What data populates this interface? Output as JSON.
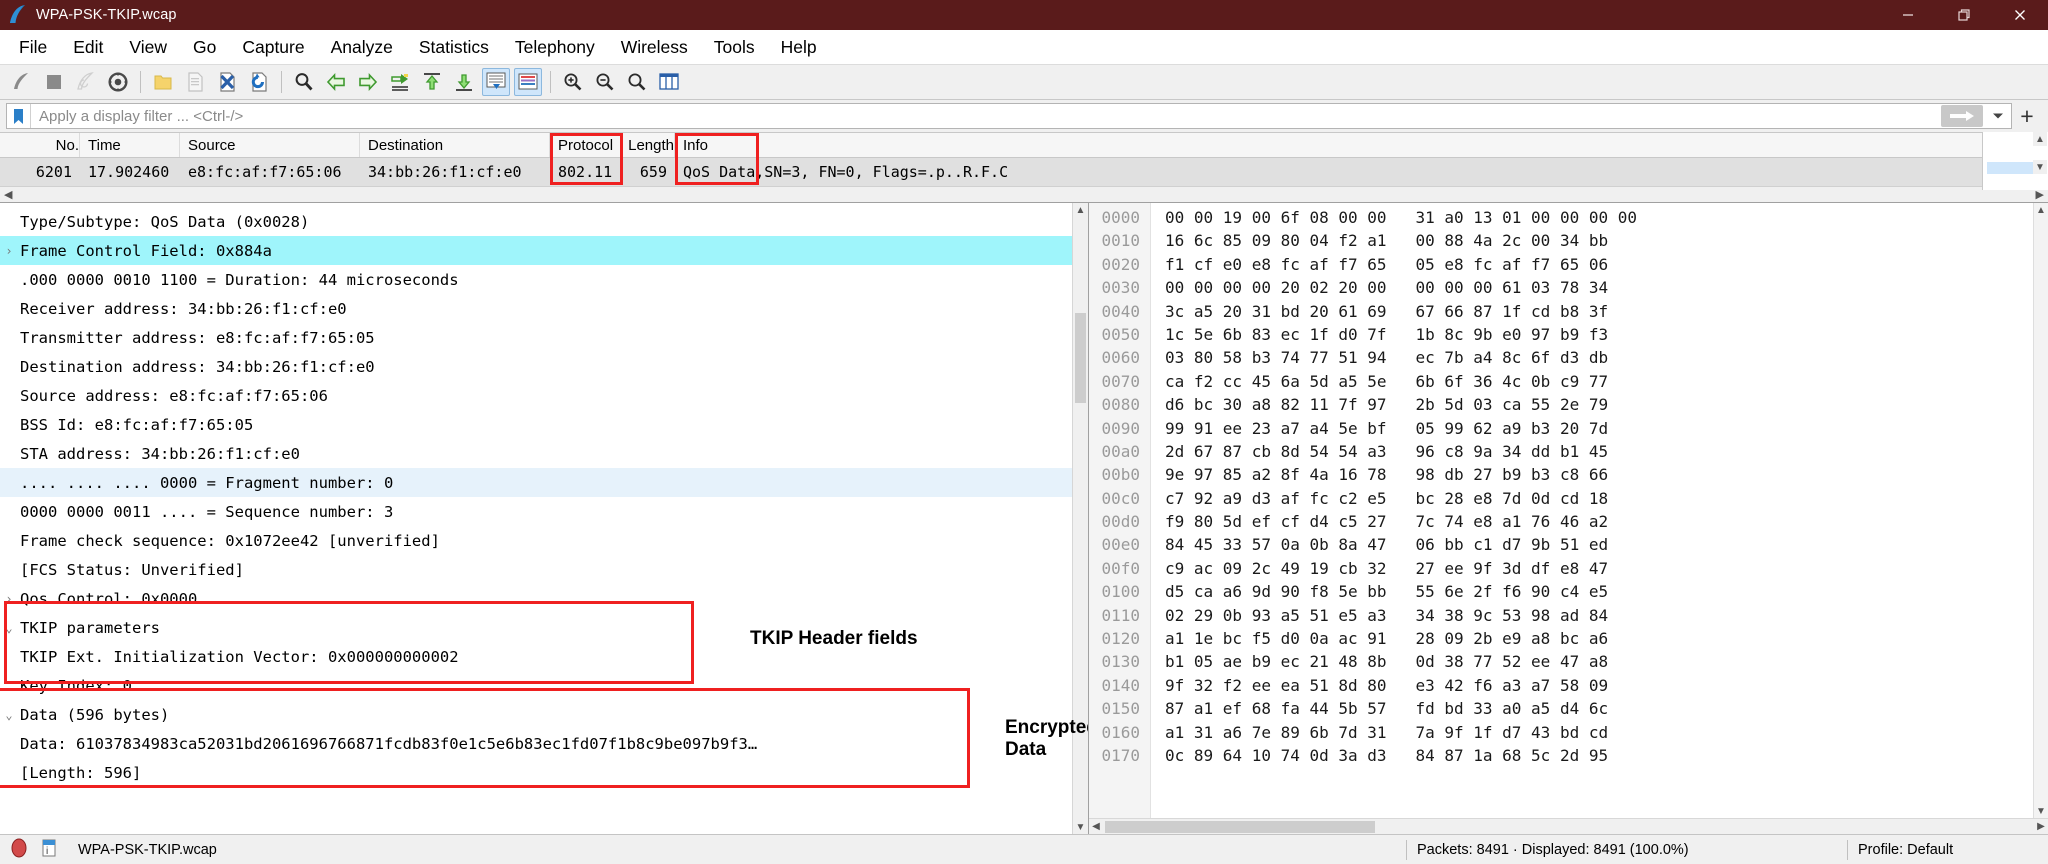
{
  "window": {
    "title": "WPA-PSK-TKIP.wcap",
    "logo_icon": "wireshark-fin-icon",
    "minimize_label": "–",
    "maximize_label": "❐",
    "close_label": "✕"
  },
  "menubar": {
    "items": [
      "File",
      "Edit",
      "View",
      "Go",
      "Capture",
      "Analyze",
      "Statistics",
      "Telephony",
      "Wireless",
      "Tools",
      "Help"
    ]
  },
  "toolbar": {
    "buttons": [
      {
        "name": "start-capture-icon",
        "label": "Start"
      },
      {
        "name": "stop-capture-icon",
        "label": "Stop"
      },
      {
        "name": "restart-capture-icon",
        "label": "Restart"
      },
      {
        "name": "capture-options-icon",
        "label": "Capture options"
      },
      {
        "name": "open-file-icon",
        "label": "Open"
      },
      {
        "name": "save-file-icon",
        "label": "Save"
      },
      {
        "name": "close-file-icon",
        "label": "Close"
      },
      {
        "name": "reload-file-icon",
        "label": "Reload"
      },
      {
        "name": "find-packet-icon",
        "label": "Find packet"
      },
      {
        "name": "go-back-icon",
        "label": "Go back"
      },
      {
        "name": "go-forward-icon",
        "label": "Go forward"
      },
      {
        "name": "go-to-packet-icon",
        "label": "Go to packet"
      },
      {
        "name": "go-first-packet-icon",
        "label": "Go to first packet"
      },
      {
        "name": "go-last-packet-icon",
        "label": "Go to last packet"
      },
      {
        "name": "autoscroll-icon",
        "label": "Auto scroll"
      },
      {
        "name": "colorize-icon",
        "label": "Colorize"
      },
      {
        "name": "zoom-in-icon",
        "label": "Zoom in"
      },
      {
        "name": "zoom-out-icon",
        "label": "Zoom out"
      },
      {
        "name": "zoom-reset-icon",
        "label": "Normal size"
      },
      {
        "name": "resize-columns-icon",
        "label": "Resize columns"
      }
    ]
  },
  "filter": {
    "bookmark_icon": "bookmark-icon",
    "placeholder": "Apply a display filter ... <Ctrl-/>",
    "value": "",
    "apply_icon": "arrow-right-icon",
    "dropdown_icon": "chevron-down-icon",
    "add_icon": "plus-icon"
  },
  "packet_list": {
    "columns": [
      "No.",
      "Time",
      "Source",
      "Destination",
      "Protocol",
      "Length",
      "Info"
    ],
    "highlighted_columns": [
      "Protocol",
      "Info"
    ],
    "rows": [
      {
        "no": "6201",
        "time": "17.902460",
        "source": "e8:fc:af:f7:65:06",
        "destination": "34:bb:26:f1:cf:e0",
        "protocol": "802.11",
        "length": "659",
        "info_highlight": "QoS Data,",
        "info_rest": " SN=3, FN=0, Flags=.p..R.F.C"
      }
    ]
  },
  "detail_tree": {
    "rows": [
      {
        "twisty": "",
        "indent": 1,
        "text": "Type/Subtype: QoS Data (0x0028)",
        "highlight": "none"
      },
      {
        "twisty": "›",
        "indent": 1,
        "text": "Frame Control Field: 0x884a",
        "highlight": "cyan"
      },
      {
        "twisty": "",
        "indent": 1,
        "text": ".000 0000 0010 1100 = Duration: 44 microseconds",
        "highlight": "none"
      },
      {
        "twisty": "",
        "indent": 1,
        "text": "Receiver address: 34:bb:26:f1:cf:e0",
        "highlight": "none"
      },
      {
        "twisty": "",
        "indent": 1,
        "text": "Transmitter address: e8:fc:af:f7:65:05",
        "highlight": "none"
      },
      {
        "twisty": "",
        "indent": 1,
        "text": "Destination address: 34:bb:26:f1:cf:e0",
        "highlight": "none"
      },
      {
        "twisty": "",
        "indent": 1,
        "text": "Source address: e8:fc:af:f7:65:06",
        "highlight": "none"
      },
      {
        "twisty": "",
        "indent": 1,
        "text": "BSS Id: e8:fc:af:f7:65:05",
        "highlight": "none"
      },
      {
        "twisty": "",
        "indent": 1,
        "text": "STA address: 34:bb:26:f1:cf:e0",
        "highlight": "none"
      },
      {
        "twisty": "",
        "indent": 1,
        "text": ".... .... .... 0000 = Fragment number: 0",
        "highlight": "blue"
      },
      {
        "twisty": "",
        "indent": 1,
        "text": "0000 0000 0011 .... = Sequence number: 3",
        "highlight": "none"
      },
      {
        "twisty": "",
        "indent": 1,
        "text": "Frame check sequence: 0x1072ee42 [unverified]",
        "highlight": "none"
      },
      {
        "twisty": "",
        "indent": 1,
        "text": "[FCS Status: Unverified]",
        "highlight": "none"
      },
      {
        "twisty": "›",
        "indent": 1,
        "text": "Qos Control: 0x0000",
        "highlight": "none"
      },
      {
        "twisty": "⌄",
        "indent": 1,
        "text": "TKIP parameters",
        "highlight": "none"
      },
      {
        "twisty": "",
        "indent": 2,
        "text": "TKIP Ext. Initialization Vector: 0x000000000002",
        "highlight": "none"
      },
      {
        "twisty": "",
        "indent": 2,
        "text": "Key Index: 0",
        "highlight": "none"
      },
      {
        "twisty": "⌄",
        "indent": 0,
        "text": "Data (596 bytes)",
        "highlight": "none"
      },
      {
        "twisty": "",
        "indent": 2,
        "text": "Data: 61037834983ca52031bd2061696766871fcdb83f0e1c5e6b83ec1fd07f1b8c9be097b9f3…",
        "highlight": "none"
      },
      {
        "twisty": "",
        "indent": 2,
        "text": "[Length: 596]",
        "highlight": "none"
      }
    ]
  },
  "annotations": [
    {
      "name": "tkip-header-fields-annotation",
      "text": "TKIP Header fields"
    },
    {
      "name": "encrypted-data-annotation",
      "text": "Encrypted Data"
    }
  ],
  "hex_dump": {
    "rows": [
      {
        "offset": "0000",
        "bytes": "00 00 19 00 6f 08 00 00   31 a0 13 01 00 00 00 00"
      },
      {
        "offset": "0010",
        "bytes": "16 6c 85 09 80 04 f2 a1   00 88 4a 2c 00 34 bb"
      },
      {
        "offset": "0020",
        "bytes": "f1 cf e0 e8 fc af f7 65   05 e8 fc af f7 65 06"
      },
      {
        "offset": "0030",
        "bytes": "00 00 00 00 20 02 20 00   00 00 00 61 03 78 34"
      },
      {
        "offset": "0040",
        "bytes": "3c a5 20 31 bd 20 61 69   67 66 87 1f cd b8 3f"
      },
      {
        "offset": "0050",
        "bytes": "1c 5e 6b 83 ec 1f d0 7f   1b 8c 9b e0 97 b9 f3"
      },
      {
        "offset": "0060",
        "bytes": "03 80 58 b3 74 77 51 94   ec 7b a4 8c 6f d3 db"
      },
      {
        "offset": "0070",
        "bytes": "ca f2 cc 45 6a 5d a5 5e   6b 6f 36 4c 0b c9 77"
      },
      {
        "offset": "0080",
        "bytes": "d6 bc 30 a8 82 11 7f 97   2b 5d 03 ca 55 2e 79"
      },
      {
        "offset": "0090",
        "bytes": "99 91 ee 23 a7 a4 5e bf   05 99 62 a9 b3 20 7d"
      },
      {
        "offset": "00a0",
        "bytes": "2d 67 87 cb 8d 54 54 a3   96 c8 9a 34 dd b1 45"
      },
      {
        "offset": "00b0",
        "bytes": "9e 97 85 a2 8f 4a 16 78   98 db 27 b9 b3 c8 66"
      },
      {
        "offset": "00c0",
        "bytes": "c7 92 a9 d3 af fc c2 e5   bc 28 e8 7d 0d cd 18"
      },
      {
        "offset": "00d0",
        "bytes": "f9 80 5d ef cf d4 c5 27   7c 74 e8 a1 76 46 a2"
      },
      {
        "offset": "00e0",
        "bytes": "84 45 33 57 0a 0b 8a 47   06 bb c1 d7 9b 51 ed"
      },
      {
        "offset": "00f0",
        "bytes": "c9 ac 09 2c 49 19 cb 32   27 ee 9f 3d df e8 47"
      },
      {
        "offset": "0100",
        "bytes": "d5 ca a6 9d 90 f8 5e bb   55 6e 2f f6 90 c4 e5"
      },
      {
        "offset": "0110",
        "bytes": "02 29 0b 93 a5 51 e5 a3   34 38 9c 53 98 ad 84"
      },
      {
        "offset": "0120",
        "bytes": "a1 1e bc f5 d0 0a ac 91   28 09 2b e9 a8 bc a6"
      },
      {
        "offset": "0130",
        "bytes": "b1 05 ae b9 ec 21 48 8b   0d 38 77 52 ee 47 a8"
      },
      {
        "offset": "0140",
        "bytes": "9f 32 f2 ee ea 51 8d 80   e3 42 f6 a3 a7 58 09"
      },
      {
        "offset": "0150",
        "bytes": "87 a1 ef 68 fa 44 5b 57   fd bd 33 a0 a5 d4 6c"
      },
      {
        "offset": "0160",
        "bytes": "a1 31 a6 7e 89 6b 7d 31   7a 9f 1f d7 43 bd cd"
      },
      {
        "offset": "0170",
        "bytes": "0c 89 64 10 74 0d 3a d3   84 87 1a 68 5c 2d 95"
      }
    ]
  },
  "statusbar": {
    "expert_icon": "expert-info-icon",
    "capture_file_icon": "capture-comment-icon",
    "filename": "WPA-PSK-TKIP.wcap",
    "packets": "Packets: 8491 · Displayed: 8491 (100.0%)",
    "profile": "Profile: Default"
  },
  "colors": {
    "titlebar": "#5a1b1b",
    "annotation_red": "#ef2020",
    "selection_cyan": "#9ff5fb",
    "row_highlight_blue": "#e6f2fb"
  }
}
